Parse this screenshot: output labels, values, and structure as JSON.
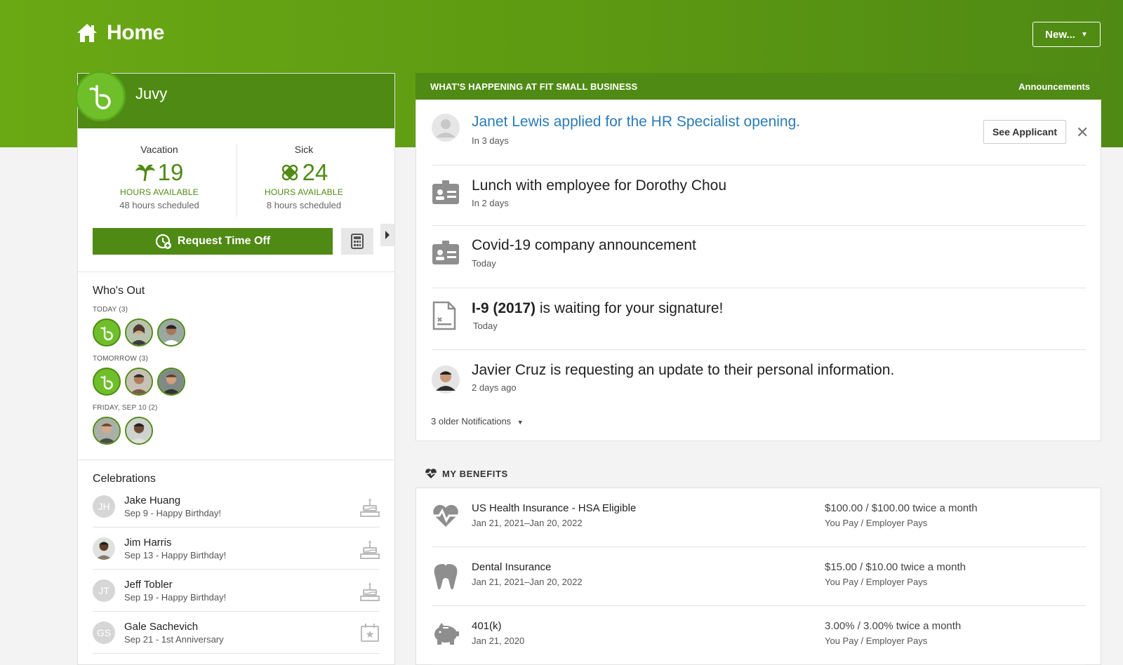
{
  "header": {
    "title": "Home",
    "new_button": "New..."
  },
  "profile": {
    "name": "Juvy"
  },
  "time_off": {
    "vacation": {
      "label": "Vacation",
      "hours": "19",
      "available_label": "HOURS AVAILABLE",
      "scheduled": "48 hours scheduled"
    },
    "sick": {
      "label": "Sick",
      "hours": "24",
      "available_label": "HOURS AVAILABLE",
      "scheduled": "8 hours scheduled"
    },
    "request_button": "Request Time Off"
  },
  "whos_out": {
    "title": "Who's Out",
    "groups": [
      {
        "label": "TODAY (3)"
      },
      {
        "label": "TOMORROW (3)"
      },
      {
        "label": "FRIDAY, SEP 10 (2)"
      }
    ]
  },
  "celebrations": {
    "title": "Celebrations",
    "items": [
      {
        "initials": "JH",
        "name": "Jake Huang",
        "sub": "Sep 9 - Happy Birthday!"
      },
      {
        "initials": "",
        "name": "Jim Harris",
        "sub": "Sep 13 - Happy Birthday!"
      },
      {
        "initials": "JT",
        "name": "Jeff Tobler",
        "sub": "Sep 19 - Happy Birthday!"
      },
      {
        "initials": "GS",
        "name": "Gale Sachevich",
        "sub": "Sep 21 - 1st Anniversary"
      }
    ]
  },
  "feed": {
    "title": "WHAT'S HAPPENING AT FIT SMALL BUSINESS",
    "announcements_link": "Announcements",
    "items": [
      {
        "title": "Janet Lewis applied for the HR Specialist opening.",
        "sub": "In 3 days"
      },
      {
        "title": "Lunch with employee for Dorothy Chou",
        "sub": "In 2 days"
      },
      {
        "title": "Covid-19 company announcement",
        "sub": "Today"
      },
      {
        "title_bold": "I-9 (2017)",
        "title_rest": " is waiting for your signature!",
        "sub": "Today"
      },
      {
        "title": "Javier Cruz is requesting an update to their personal information.",
        "sub": "2 days ago"
      }
    ],
    "see_applicant": "See Applicant",
    "older": "3 older Notifications"
  },
  "benefits": {
    "title": "MY BENEFITS",
    "items": [
      {
        "name": "US Health Insurance - HSA Eligible",
        "dates": "Jan 21, 2021–Jan 20, 2022",
        "amount": "$100.00 / $100.00 twice a month",
        "who": "You Pay / Employer Pays"
      },
      {
        "name": "Dental Insurance",
        "dates": "Jan 21, 2021–Jan 20, 2022",
        "amount": "$15.00 / $10.00 twice a month",
        "who": "You Pay / Employer Pays"
      },
      {
        "name": "401(k)",
        "dates": "Jan 21, 2020",
        "amount": "3.00% / 3.00% twice a month",
        "who": "You Pay / Employer Pays"
      }
    ]
  }
}
